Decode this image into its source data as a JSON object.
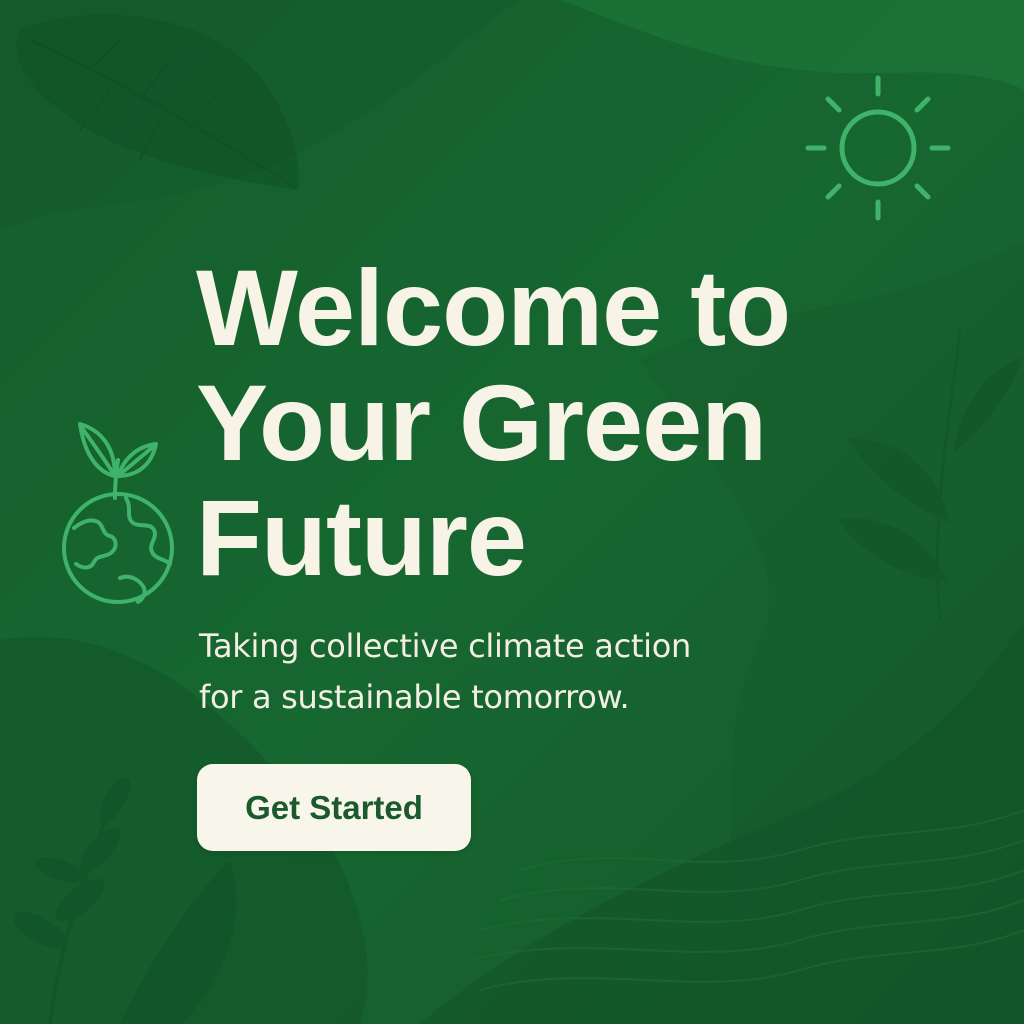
{
  "hero": {
    "title_lines": [
      "Welcome to",
      "Your Green",
      "Future"
    ],
    "subtitle_lines": [
      "Taking collective climate action",
      "for a sustainable tomorrow."
    ],
    "cta_label": "Get Started"
  },
  "icons": {
    "sun": "sun-icon",
    "earth": "sprouting-earth-icon"
  },
  "colors": {
    "background": "#17652f",
    "text": "#f7f3e7",
    "button_bg": "#f8f5ea",
    "button_text": "#1a5a2d",
    "icon_accent": "#3fb36a"
  }
}
